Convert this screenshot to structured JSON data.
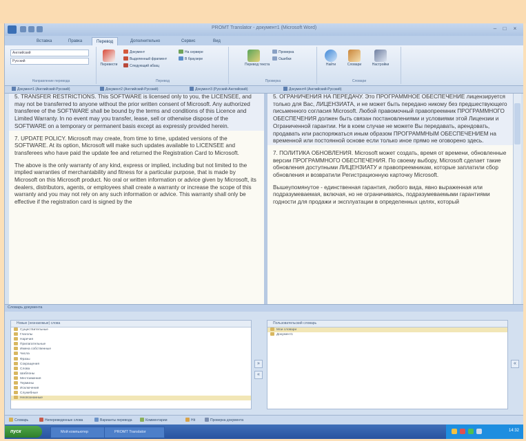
{
  "window": {
    "title": "PROMT Translator - документ1 (Microsoft Word)",
    "controls": {
      "minimize": "–",
      "maximize": "□",
      "close": "×"
    }
  },
  "ribbon_tabs": [
    "Вставка",
    "Правка",
    "Перевод",
    "Дополнительно",
    "Сервис",
    "Вид"
  ],
  "ribbon_active_tab": 2,
  "ribbon": {
    "groups": [
      {
        "label": "Направление перевода"
      },
      {
        "label": "Перевод"
      },
      {
        "label": "Проверка"
      },
      {
        "label": "Словари"
      }
    ],
    "direction_from": "Английский",
    "direction_to": "Русский",
    "big_buttons": [
      "Перевести",
      "Перевод текста",
      "Найти",
      "Словари",
      "Настройки"
    ],
    "small_buttons": [
      "Документ",
      "Выделенный фрагмент",
      "Следующий абзац",
      "На сервере",
      "В браузере",
      "Проверка",
      "Ошибки"
    ]
  },
  "doc_tabs": [
    "Документ1 (Английский-Русский)",
    "Документ2 (Английский-Русский)",
    "Документ3 (Русский-Английский)",
    "Документ4 (Английский-Русский)"
  ],
  "left_pane": {
    "paragraphs": [
      "5. TRANSFER RESTRICTIONS. This SOFTWARE is licensed only to you, the LICENSEE, and may not be transferred to anyone without the prior written consent of Microsoft. Any authorized transferee of the SOFTWARE shall be bound by the terms and conditions of this Licence and Limited Warranty. In no event may you transfer, lease, sell or otherwise dispose of the SOFTWARE on a temporary or permanent basis except as expressly provided herein.",
      "7. UPDATE POLICY. Microsoft may create, from time to time, updated versions of the SOFTWARE. At its option, Microsoft will make such updates available to LICENSEE and transferees who have paid the update fee and returned the Registration Card to Microsoft.",
      "The above is the only warranty of any kind, express or implied, including but not limited to the implied warranties of merchantability and fitness for a particular purpose, that is made by Microsoft on this Microsoft product. No oral or written information or advice given by Microsoft, its dealers, distributors, agents, or employees shall create a warranty or increase the scope of this warranty and you may not rely on any such information or advice. This warranty shall only be effective if the registration card is signed by the"
    ]
  },
  "right_pane": {
    "paragraphs": [
      "5. ОГРАНИЧЕНИЯ НА ПЕРЕДАЧУ. Это ПРОГРАММНОЕ ОБЕСПЕЧЕНИЕ лицензируется только для Вас, ЛИЦЕНЗИАТА, и не может быть передано никому без предшествующего письменного согласия Microsoft. Любой правомочный правопреемник ПРОГРАММНОГО ОБЕСПЕЧЕНИЯ должен быть связан постановлениями и условиями этой Лицензии и Ограниченной гарантии. Ни в коем случае не можете Вы передавать, арендовать, продавать или распоряжаться иным образом ПРОГРАММНЫМ ОБЕСПЕЧЕНИЕМ на временной или постоянной основе если только иное прямо не оговорено здесь.",
      "7. ПОЛИТИКА ОБНОВЛЕНИЯ. Microsoft может создать, время от времени, обновленные версии ПРОГРАММНОГО ОБЕСПЕЧЕНИЯ. По своему выбору, Microsoft сделает такие обновления доступными ЛИЦЕНЗИАТУ и правопреемникам, которые заплатили сбор обновления и возвратили Регистрационную карточку Microsoft.",
      "Вышеупомянутое - единственная гарантия, любого вида, явно выраженная или подразумеваемая, включая, но не ограничиваясь, подразумеваемыми гарантиями годности для продажи и эксплуатации в определенных целях, который"
    ]
  },
  "split_label": "Словарь документа",
  "bottom": {
    "left_list_header": "Новые (незнакомые) слова",
    "left_items": [
      "Существительные",
      "Глаголы",
      "Наречия",
      "Прилагательные",
      "Имена собственные",
      "Числа",
      "Фразы",
      "Сокращения",
      "Слова",
      "Шаблоны",
      "Местоимения",
      "Термины",
      "Исключения",
      "Служебные",
      "Неопознанные"
    ],
    "left_highlight": 14,
    "right_list_header": "Пользовательский словарь",
    "right_items": [
      "Мои словари",
      "Документ1"
    ],
    "right_highlight": 0,
    "arrow_right": "»",
    "arrow_left": "«"
  },
  "bottom_tabs": [
    "Словарь",
    "Непереведенные слова",
    "Варианты перевода",
    "Комментарии",
    "Hit",
    "Проверка документа"
  ],
  "taskbar": {
    "start": "пуск",
    "tasks": [
      "Мой компьютер",
      "PROMT Translator"
    ],
    "clock": "14:32"
  }
}
